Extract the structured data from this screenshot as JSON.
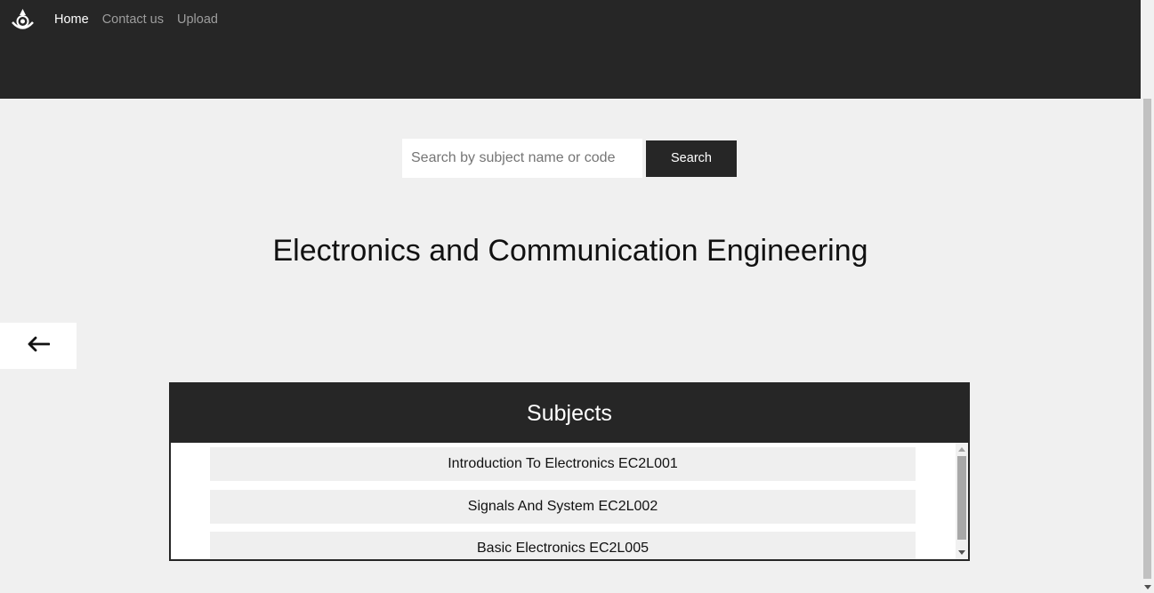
{
  "nav": {
    "links": [
      {
        "label": "Home",
        "active": true
      },
      {
        "label": "Contact us",
        "active": false
      },
      {
        "label": "Upload",
        "active": false
      }
    ]
  },
  "search": {
    "placeholder": "Search by subject name or code",
    "value": "",
    "button_label": "Search"
  },
  "page": {
    "title": "Electronics and Communication Engineering"
  },
  "subjects": {
    "header": "Subjects",
    "items": [
      "Introduction To Electronics EC2L001",
      "Signals And System EC2L002",
      "Basic Electronics EC2L005"
    ]
  },
  "colors": {
    "navbar_bg": "#262626",
    "page_bg": "#f0f0f0",
    "item_bg": "#efefef"
  }
}
